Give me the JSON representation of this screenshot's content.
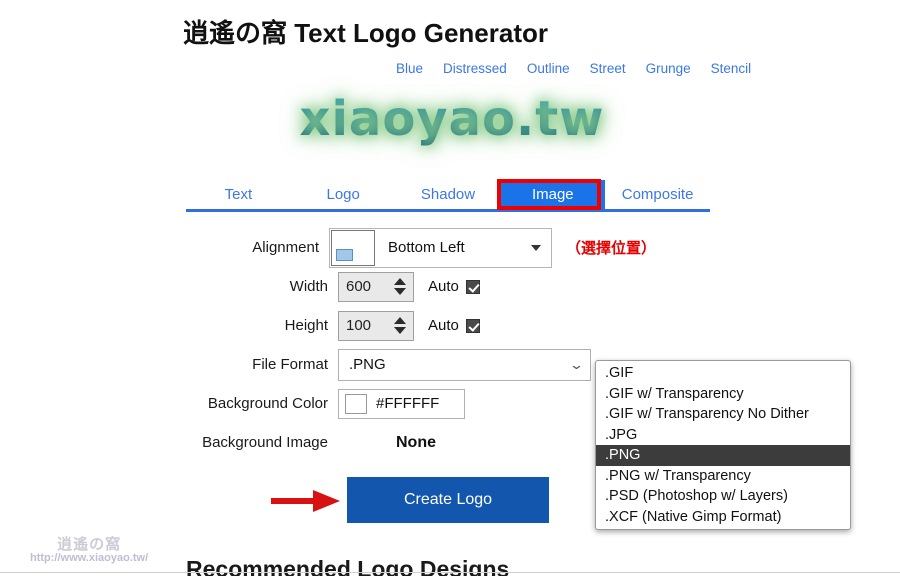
{
  "page": {
    "title": "逍遙の窩 Text Logo Generator",
    "logo_preview_text": "xiaoyao.tw",
    "bottom_heading": "Recommended Logo Designs"
  },
  "style_links": [
    {
      "label": "Blue"
    },
    {
      "label": "Distressed"
    },
    {
      "label": "Outline"
    },
    {
      "label": "Street"
    },
    {
      "label": "Grunge"
    },
    {
      "label": "Stencil"
    }
  ],
  "tabs": [
    {
      "label": "Text",
      "active": false
    },
    {
      "label": "Logo",
      "active": false
    },
    {
      "label": "Shadow",
      "active": false
    },
    {
      "label": "Image",
      "active": true
    },
    {
      "label": "Composite",
      "active": false
    }
  ],
  "form": {
    "alignment": {
      "label": "Alignment",
      "value": "Bottom Left",
      "annotation": "（選擇位置）"
    },
    "width": {
      "label": "Width",
      "value": "600",
      "auto_label": "Auto",
      "auto_checked": true
    },
    "height": {
      "label": "Height",
      "value": "100",
      "auto_label": "Auto",
      "auto_checked": true
    },
    "file_format": {
      "label": "File Format",
      "value": ".PNG",
      "options": [
        ".GIF",
        ".GIF w/ Transparency",
        ".GIF w/ Transparency No Dither",
        ".JPG",
        ".PNG",
        ".PNG w/ Transparency",
        ".PSD (Photoshop w/ Layers)",
        ".XCF (Native Gimp Format)"
      ],
      "selected_index": 4
    },
    "background_color": {
      "label": "Background Color",
      "value": "#FFFFFF",
      "swatch": "#FFFFFF"
    },
    "background_image": {
      "label": "Background Image",
      "value": "None"
    },
    "submit": {
      "label": "Create Logo"
    }
  },
  "watermark": {
    "site_name": "逍遙の窩",
    "url": "http://www.xiaoyao.tw/"
  },
  "colors": {
    "link_blue": "#3b78e7",
    "active_tab_blue": "#1a73e8",
    "highlight_red": "#ee0000",
    "button_blue": "#1257ad",
    "annotation_red": "#e60000",
    "underline_blue": "#2f6fe0"
  }
}
